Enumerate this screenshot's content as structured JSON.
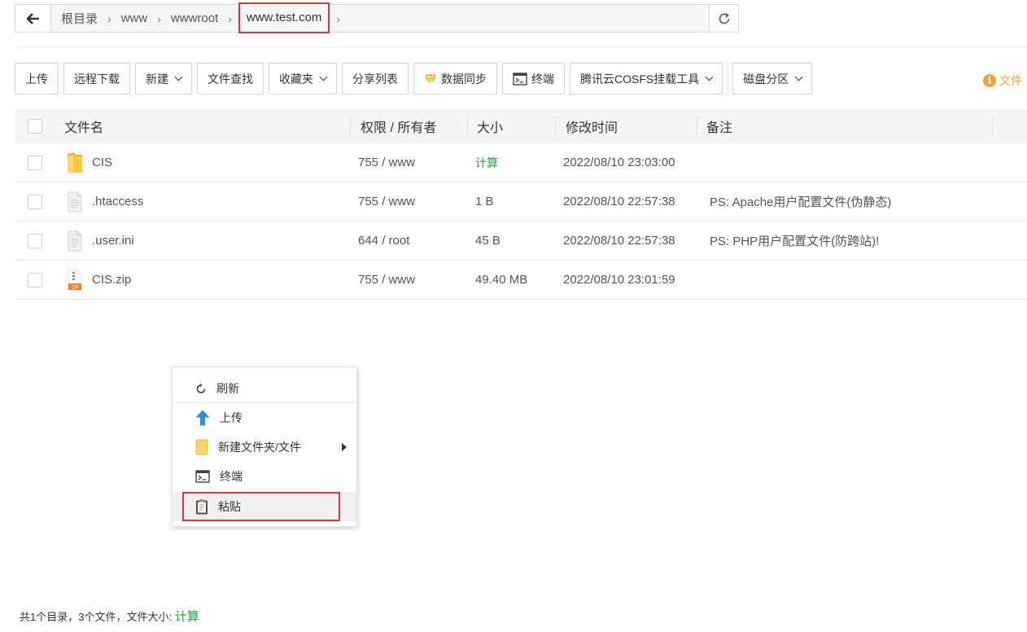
{
  "breadcrumb": {
    "items": [
      "根目录",
      "www",
      "wwwroot",
      "www.test.com"
    ]
  },
  "toolbar": {
    "upload": "上传",
    "remote_download": "远程下载",
    "new": "新建",
    "file_search": "文件查找",
    "favorites": "收藏夹",
    "share_list": "分享列表",
    "data_sync": "数据同步",
    "terminal": "终端",
    "cosfs": "腾讯云COSFS挂载工具",
    "disk_partition": "磁盘分区",
    "tip": "文件"
  },
  "table": {
    "headers": [
      "文件名",
      "权限 / 所有者",
      "大小",
      "修改时间",
      "备注"
    ],
    "rows": [
      {
        "name": "CIS",
        "perm": "755 / www",
        "size": "计算",
        "mtime": "2022/08/10 23:03:00",
        "note": "",
        "type": "folder"
      },
      {
        "name": ".htaccess",
        "perm": "755 / www",
        "size": "1 B",
        "mtime": "2022/08/10 22:57:38",
        "note": "PS: Apache用户配置文件(伪静态)",
        "type": "file"
      },
      {
        "name": ".user.ini",
        "perm": "644 / root",
        "size": "45 B",
        "mtime": "2022/08/10 22:57:38",
        "note": "PS: PHP用户配置文件(防跨站)!",
        "type": "file"
      },
      {
        "name": "CIS.zip",
        "perm": "755 / www",
        "size": "49.40 MB",
        "mtime": "2022/08/10 23:01:59",
        "note": "",
        "type": "zip"
      }
    ]
  },
  "context_menu": {
    "refresh": "刷新",
    "upload": "上传",
    "new_folder_file": "新建文件夹/文件",
    "terminal": "终端",
    "paste": "粘贴"
  },
  "footer": {
    "summary": "共1个目录，3个文件，文件大小:",
    "calc": "计算"
  },
  "colors": {
    "accent_green": "#20a53a",
    "highlight_red": "#d9363e",
    "tip_orange": "#f0a43a",
    "folder_yellow": "#f7c84a"
  }
}
